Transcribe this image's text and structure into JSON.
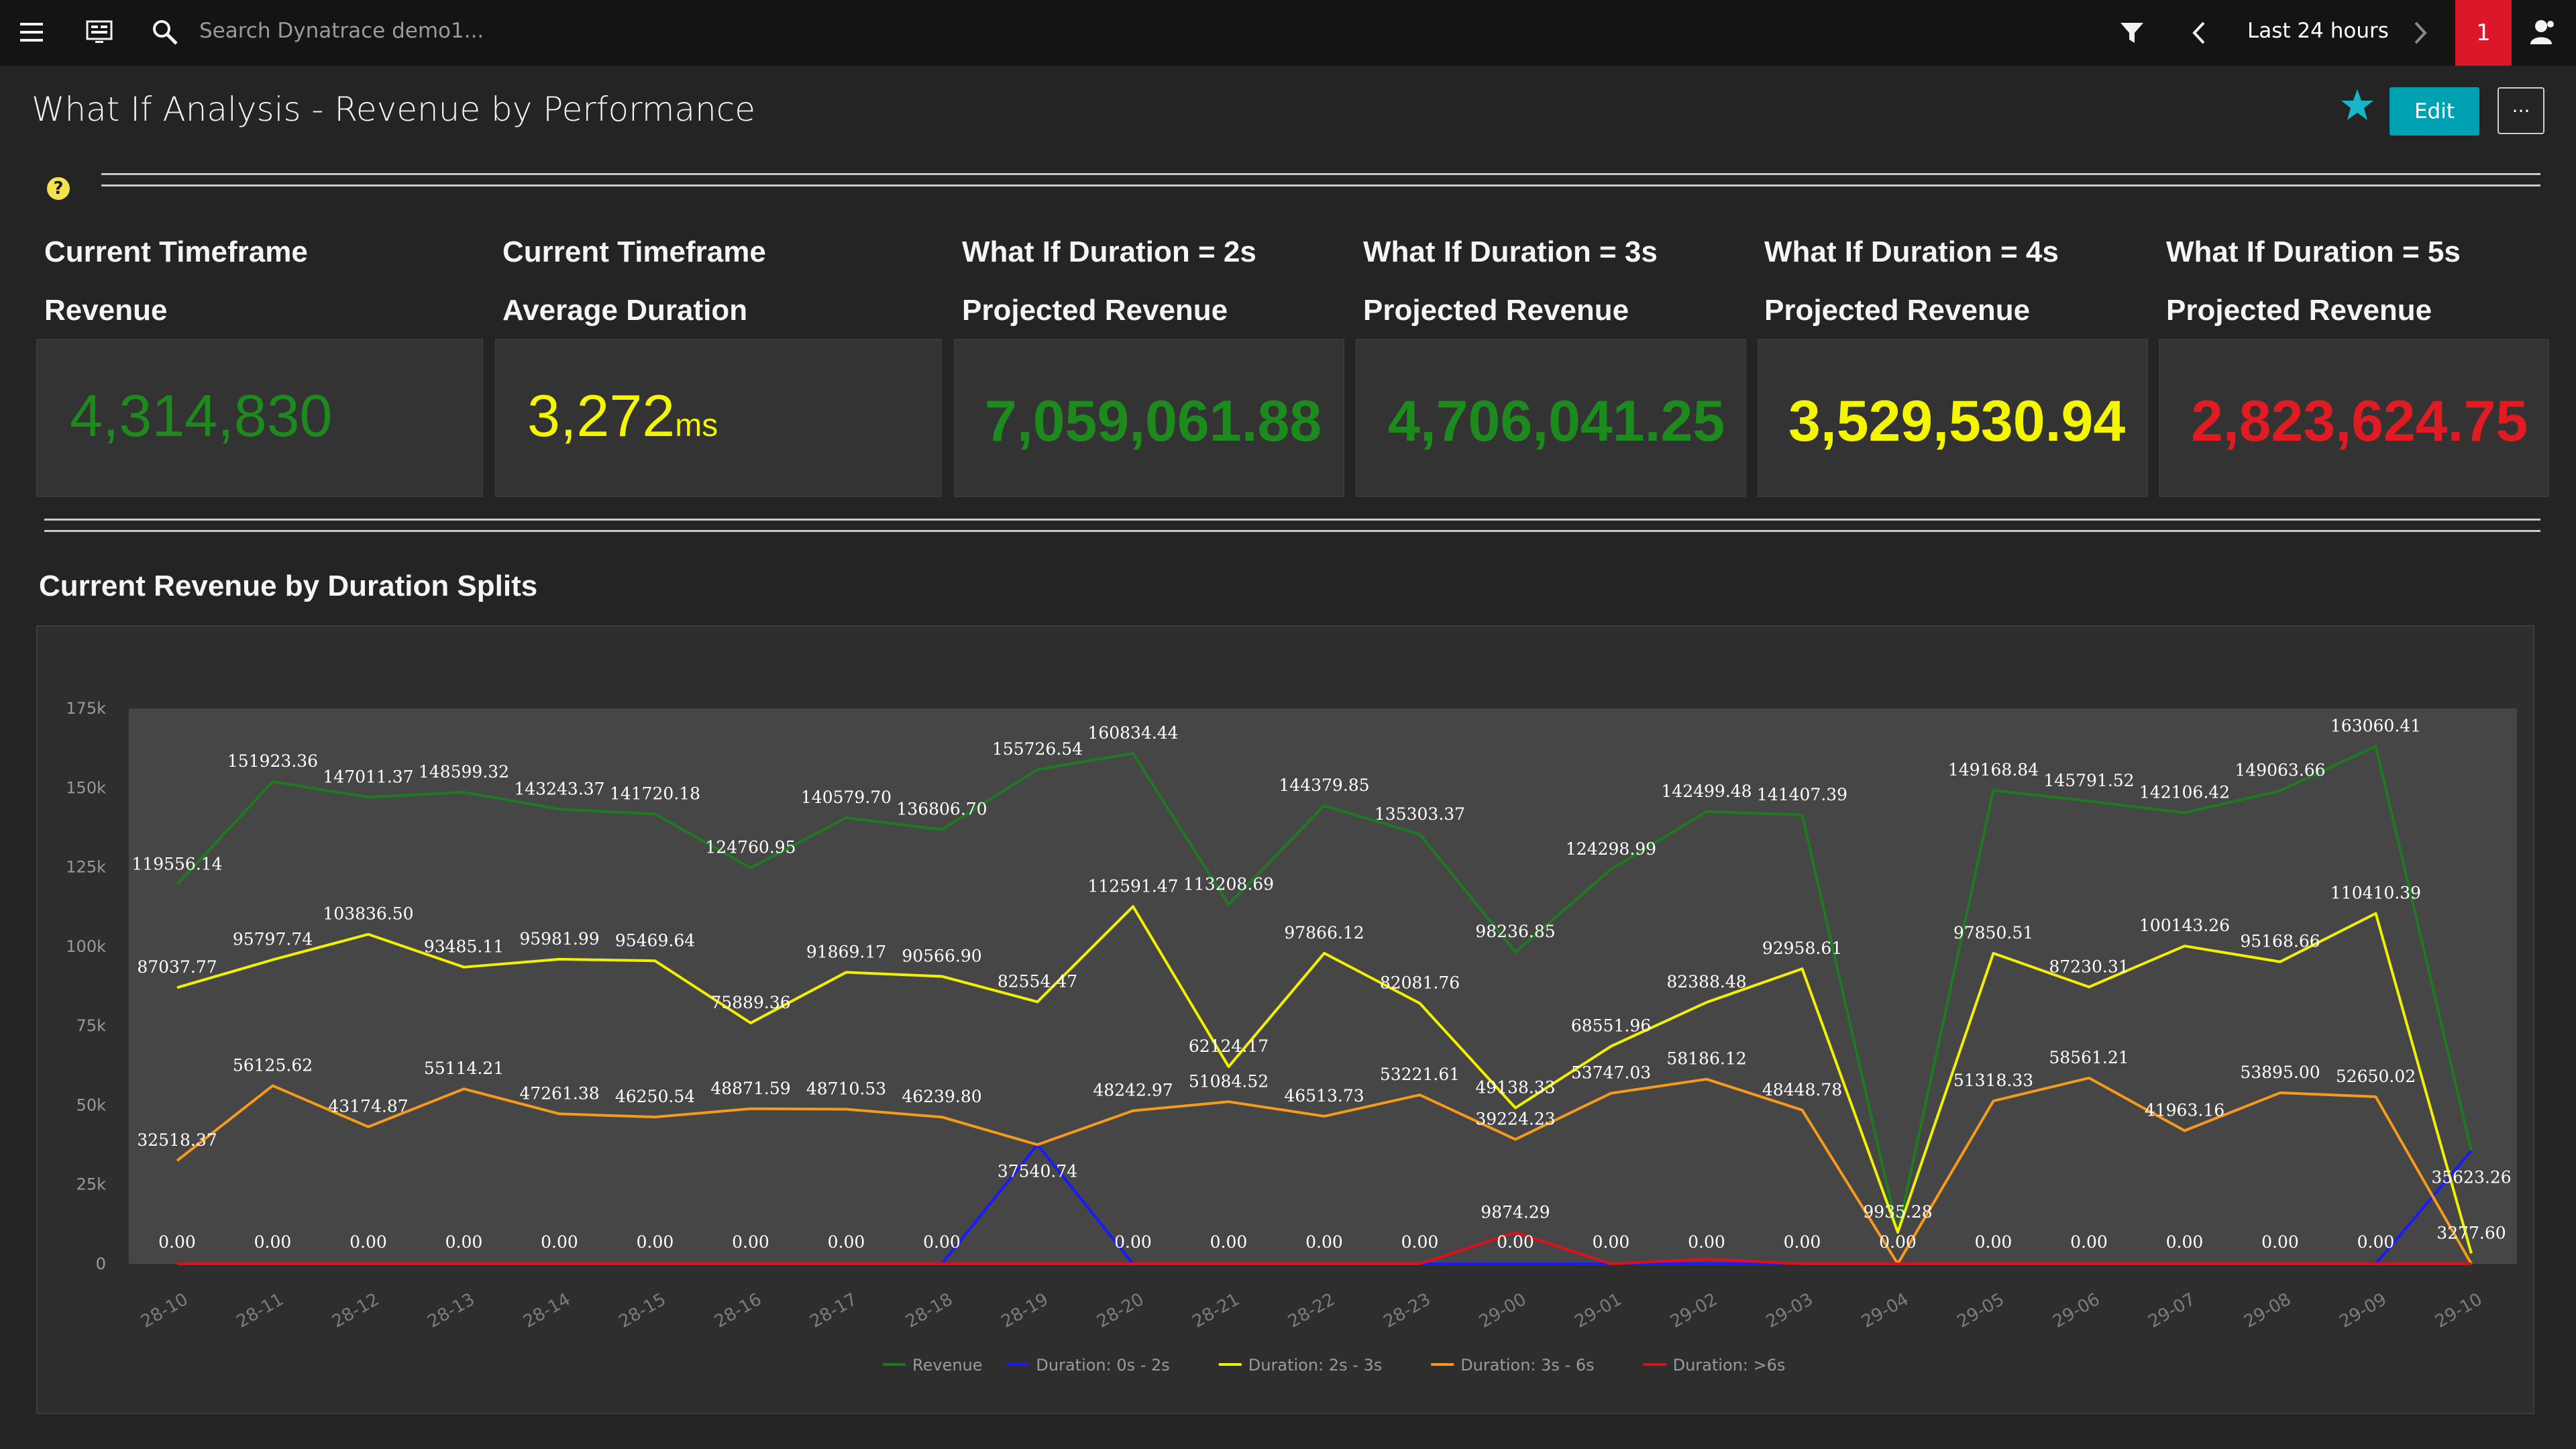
{
  "topbar": {
    "search_placeholder": "Search Dynatrace demo1...",
    "timeframe": "Last 24 hours",
    "alert_count": "1"
  },
  "header": {
    "title": "What If Analysis - Revenue by Performance",
    "edit_label": "Edit",
    "more_label": "···"
  },
  "help": {
    "icon": "?"
  },
  "tiles": [
    {
      "line1": "Current Timeframe",
      "line2": "Revenue",
      "value": "4,314,830",
      "unit": "",
      "color": "#1c8a1c"
    },
    {
      "line1": "Current Timeframe",
      "line2": "Average Duration",
      "value": "3,272",
      "unit": "ms",
      "color": "#f4f500"
    },
    {
      "line1": "What If Duration = 2s",
      "line2": "Projected Revenue",
      "value": "7,059,061.88",
      "unit": "",
      "color": "#1c8a1c"
    },
    {
      "line1": "What If Duration = 3s",
      "line2": "Projected Revenue",
      "value": "4,706,041.25",
      "unit": "",
      "color": "#1c8a1c"
    },
    {
      "line1": "What If Duration = 4s",
      "line2": "Projected Revenue",
      "value": "3,529,530.94",
      "unit": "",
      "color": "#f4f500"
    },
    {
      "line1": "What If Duration = 5s",
      "line2": "Projected Revenue",
      "value": "2,823,624.75",
      "unit": "",
      "color": "#e01b22"
    }
  ],
  "section": {
    "title": "Current Revenue by Duration Splits"
  },
  "chart_data": {
    "type": "line",
    "categories": [
      "28-10",
      "28-11",
      "28-12",
      "28-13",
      "28-14",
      "28-15",
      "28-16",
      "28-17",
      "28-18",
      "28-19",
      "28-20",
      "28-21",
      "28-22",
      "28-23",
      "29-00",
      "29-01",
      "29-02",
      "29-03",
      "29-04",
      "29-05",
      "29-06",
      "29-07",
      "29-08",
      "29-09",
      "29-10"
    ],
    "ylim": [
      0,
      175000
    ],
    "yticks": [
      0,
      25000,
      50000,
      75000,
      100000,
      125000,
      150000,
      175000
    ],
    "ytick_labels": [
      "0",
      "25k",
      "50k",
      "75k",
      "100k",
      "125k",
      "150k",
      "175k"
    ],
    "legend_position": "bottom-center",
    "grid": false,
    "series": [
      {
        "name": "Revenue",
        "color": "#1e7a1e",
        "show_labels": true,
        "values": [
          119556.14,
          151923.36,
          147011.37,
          148599.32,
          143243.37,
          141720.18,
          124760.95,
          140579.7,
          136806.7,
          155726.54,
          160834.44,
          113208.69,
          144379.85,
          135303.37,
          98236.85,
          124298.99,
          142499.48,
          141407.39,
          null,
          149168.84,
          145791.52,
          142106.42,
          149063.66,
          163060.41,
          null
        ],
        "labels": [
          "119556.14",
          "151923.36",
          "147011.37",
          "148599.32",
          "143243.37",
          "141720.18",
          "124760.95",
          "140579.70",
          "136806.70",
          "155726.54",
          "160834.44",
          "113208.69",
          "144379.85",
          "135303.37",
          "98236.85",
          "124298.99",
          "142499.48",
          "141407.39",
          "",
          "149168.84",
          "145791.52",
          "142106.42",
          "149063.66",
          "163060.41",
          ""
        ],
        "draw": [
          119556.14,
          151923.36,
          147011.37,
          148599.32,
          143243.37,
          141720.18,
          124760.95,
          140579.7,
          136806.7,
          155726.54,
          160834.44,
          113208.69,
          144379.85,
          135303.37,
          98236.85,
          124298.99,
          142499.48,
          141407.39,
          9935.28,
          149168.84,
          145791.52,
          142106.42,
          149063.66,
          163060.41,
          35623.26
        ]
      },
      {
        "name": "Duration: 0s - 2s",
        "color": "#1a1aff",
        "show_labels": true,
        "values": [
          0,
          0,
          0,
          0,
          0,
          0,
          0,
          0,
          0,
          37540.74,
          0,
          0,
          0,
          0,
          0,
          0,
          0,
          0,
          0,
          0,
          0,
          0,
          0,
          0,
          35623.26
        ],
        "labels": [
          "0.00",
          "0.00",
          "0.00",
          "0.00",
          "0.00",
          "0.00",
          "0.00",
          "0.00",
          "0.00",
          "37540.74",
          "0.00",
          "0.00",
          "0.00",
          "0.00",
          "0.00",
          "0.00",
          "0.00",
          "0.00",
          "0.00",
          "0.00",
          "0.00",
          "0.00",
          "0.00",
          "0.00",
          "35623.26"
        ]
      },
      {
        "name": "Duration: 2s - 3s",
        "color": "#f0f000",
        "show_labels": true,
        "values": [
          87037.77,
          95797.74,
          103836.5,
          93485.11,
          95981.99,
          95469.64,
          75889.36,
          91869.17,
          90566.9,
          82554.47,
          112591.47,
          62124.17,
          97866.12,
          82081.76,
          49138.33,
          68551.96,
          82388.48,
          92958.61,
          9935.28,
          97850.51,
          87230.31,
          100143.26,
          95168.66,
          110410.39,
          3277.6
        ],
        "labels": [
          "87037.77",
          "95797.74",
          "103836.50",
          "93485.11",
          "95981.99",
          "95469.64",
          "75889.36",
          "91869.17",
          "90566.90",
          "82554.47",
          "112591.47",
          "62124.17",
          "97866.12",
          "82081.76",
          "49138.33",
          "68551.96",
          "82388.48",
          "92958.61",
          "9935.28",
          "97850.51",
          "87230.31",
          "100143.26",
          "95168.66",
          "110410.39",
          "3277.60"
        ]
      },
      {
        "name": "Duration: 3s - 6s",
        "color": "#f59a1b",
        "show_labels": true,
        "values": [
          32518.37,
          56125.62,
          43174.87,
          55114.21,
          47261.38,
          46250.54,
          48871.59,
          48710.53,
          46239.8,
          37540.74,
          48242.97,
          51084.52,
          46513.73,
          53221.61,
          39224.23,
          53747.03,
          58186.12,
          48448.78,
          0,
          51318.33,
          58561.21,
          41963.16,
          53895.0,
          52650.02,
          0
        ],
        "labels": [
          "32518.37",
          "56125.62",
          "43174.87",
          "55114.21",
          "47261.38",
          "46250.54",
          "48871.59",
          "48710.53",
          "46239.80",
          "",
          "48242.97",
          "51084.52",
          "46513.73",
          "53221.61",
          "39224.23",
          "53747.03",
          "58186.12",
          "48448.78",
          "",
          "51318.33",
          "58561.21",
          "41963.16",
          "53895.00",
          "52650.02",
          ""
        ]
      },
      {
        "name": "Duration: >6s",
        "color": "#e0101a",
        "show_labels": false,
        "values": [
          0,
          0,
          0,
          0,
          0,
          0,
          0,
          0,
          0,
          0,
          0,
          0,
          0,
          0,
          9874.29,
          0,
          1500,
          0,
          0,
          0,
          0,
          0,
          0,
          0,
          0
        ],
        "labels": [
          "",
          "",
          "",
          "",
          "",
          "",
          "",
          "",
          "",
          "",
          "",
          "",
          "",
          "",
          "9874.29",
          "",
          "",
          "",
          "",
          "",
          "",
          "",
          "",
          "",
          ""
        ]
      }
    ]
  }
}
